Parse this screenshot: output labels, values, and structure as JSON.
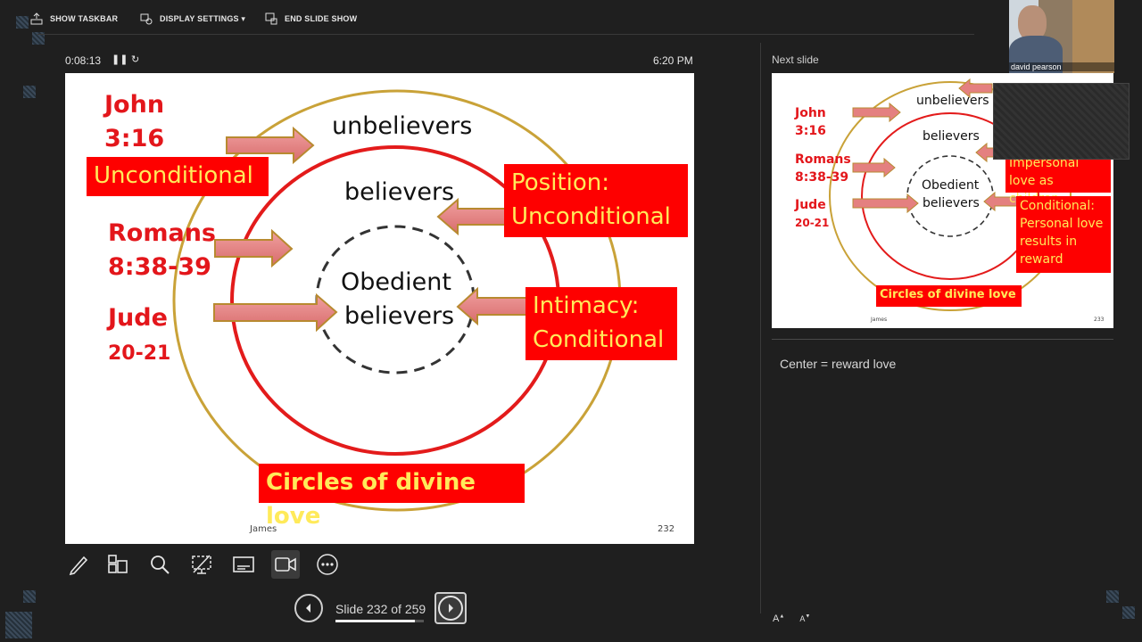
{
  "toolbar": {
    "show_taskbar": "SHOW TASKBAR",
    "display_settings": "DISPLAY SETTINGS ▾",
    "end_slide_show": "END SLIDE SHOW"
  },
  "timer": {
    "elapsed": "0:08:13",
    "clock": "6:20 PM"
  },
  "slide": {
    "labels": {
      "john": "John",
      "john_ref": "3:16",
      "romans": "Romans",
      "romans_ref": "8:38-39",
      "jude": "Jude",
      "jude_ref": "20-21"
    },
    "circles": {
      "outer": "unbelievers",
      "middle": "believers",
      "inner_1": "Obedient",
      "inner_2": "believers"
    },
    "boxes": {
      "unconditional": "Unconditional",
      "position_1": "Position:",
      "position_2": "Unconditional",
      "intimacy_1": "Intimacy:",
      "intimacy_2": "Conditional",
      "title": "Circles of divine love"
    },
    "footer": "James",
    "page_number": "232"
  },
  "next_slide": {
    "heading": "Next slide",
    "labels": {
      "john": "John",
      "john_ref": "3:16",
      "romans": "Romans",
      "romans_ref": "8:38-39",
      "jude": "Jude",
      "jude_ref": "20-21"
    },
    "circles": {
      "outer": "unbelievers",
      "middle": "believers",
      "inner_1": "Obedient",
      "inner_2": "believers"
    },
    "boxes": {
      "impersonal_1": "Impersonal",
      "impersonal_2": "love as children",
      "conditional_1": "Conditional:",
      "conditional_2": "Personal love",
      "conditional_3": "results in",
      "conditional_4": "reward",
      "title": "Circles of divine love"
    },
    "footer": "James",
    "page_number": "233"
  },
  "notes": "Center = reward love",
  "navigation": {
    "slide_counter": "Slide 232 of 259",
    "progress": 0.896
  },
  "webcam": {
    "name": "david pearson"
  },
  "font_controls": {
    "increase": "A",
    "decrease": "A"
  },
  "colors": {
    "accent_red": "#fe0000",
    "label_red": "#e3161b",
    "box_text": "#ffea5a",
    "gold_ring": "#c9a238"
  }
}
